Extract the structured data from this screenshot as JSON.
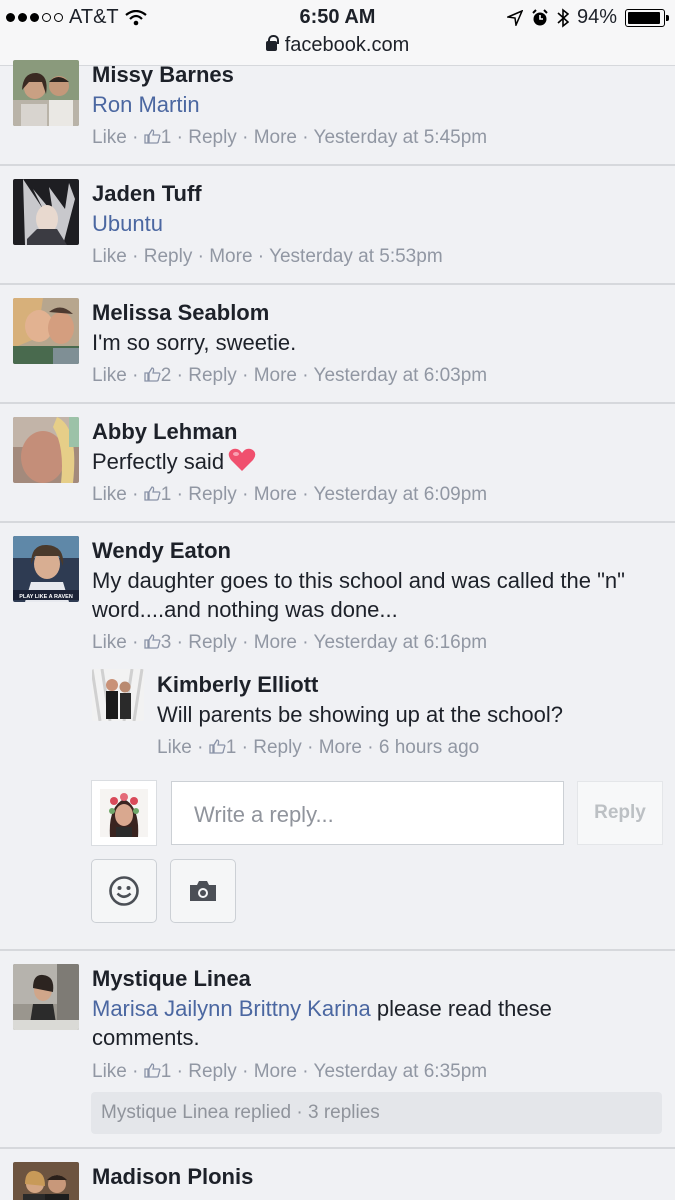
{
  "status": {
    "carrier": "AT&T",
    "time": "6:50 AM",
    "battery": "94%"
  },
  "browser": {
    "url": "facebook.com"
  },
  "comments": [
    {
      "name": "Missy Barnes",
      "tag": "Ron Martin",
      "text": "",
      "likes": "1",
      "time": "Yesterday at 5:45pm"
    },
    {
      "name": "Jaden Tuff",
      "tag": "Ubuntu",
      "text": "",
      "likes": "",
      "time": "Yesterday at 5:53pm"
    },
    {
      "name": "Melissa Seablom",
      "tag": "",
      "text": "I'm so sorry, sweetie.",
      "likes": "2",
      "time": "Yesterday at 6:03pm"
    },
    {
      "name": "Abby Lehman",
      "tag": "",
      "text": "Perfectly said",
      "likes": "1",
      "time": "Yesterday at 6:09pm"
    },
    {
      "name": "Wendy Eaton",
      "tag": "",
      "text": "My daughter goes to this school and was called the \"n\" word....and nothing was done...",
      "likes": "3",
      "time": "Yesterday at 6:16pm"
    },
    {
      "name": "Mystique Linea",
      "tag": "Marisa Jailynn Brittny Karina",
      "text": " please read these comments.",
      "likes": "1",
      "time": "Yesterday at 6:35pm"
    },
    {
      "name": "Madison Plonis",
      "tag": "",
      "text": "",
      "likes": "",
      "time": ""
    }
  ],
  "reply": {
    "name": "Kimberly Elliott",
    "text": "Will parents be showing up at the school?",
    "likes": "1",
    "time": "6 hours ago"
  },
  "actions": {
    "like": "Like",
    "reply": "Reply",
    "more": "More",
    "sep": "·"
  },
  "composer": {
    "placeholder": "Write a reply...",
    "button": "Reply"
  },
  "replies_summary": "Mystique Linea replied · 3 replies",
  "avatar_badge": "PLAY LIKE A RAVEN",
  "colors": {
    "link": "#4b67a1",
    "meta": "#9197a3",
    "divider": "#d6d8dc",
    "heart": "#f0506e"
  }
}
